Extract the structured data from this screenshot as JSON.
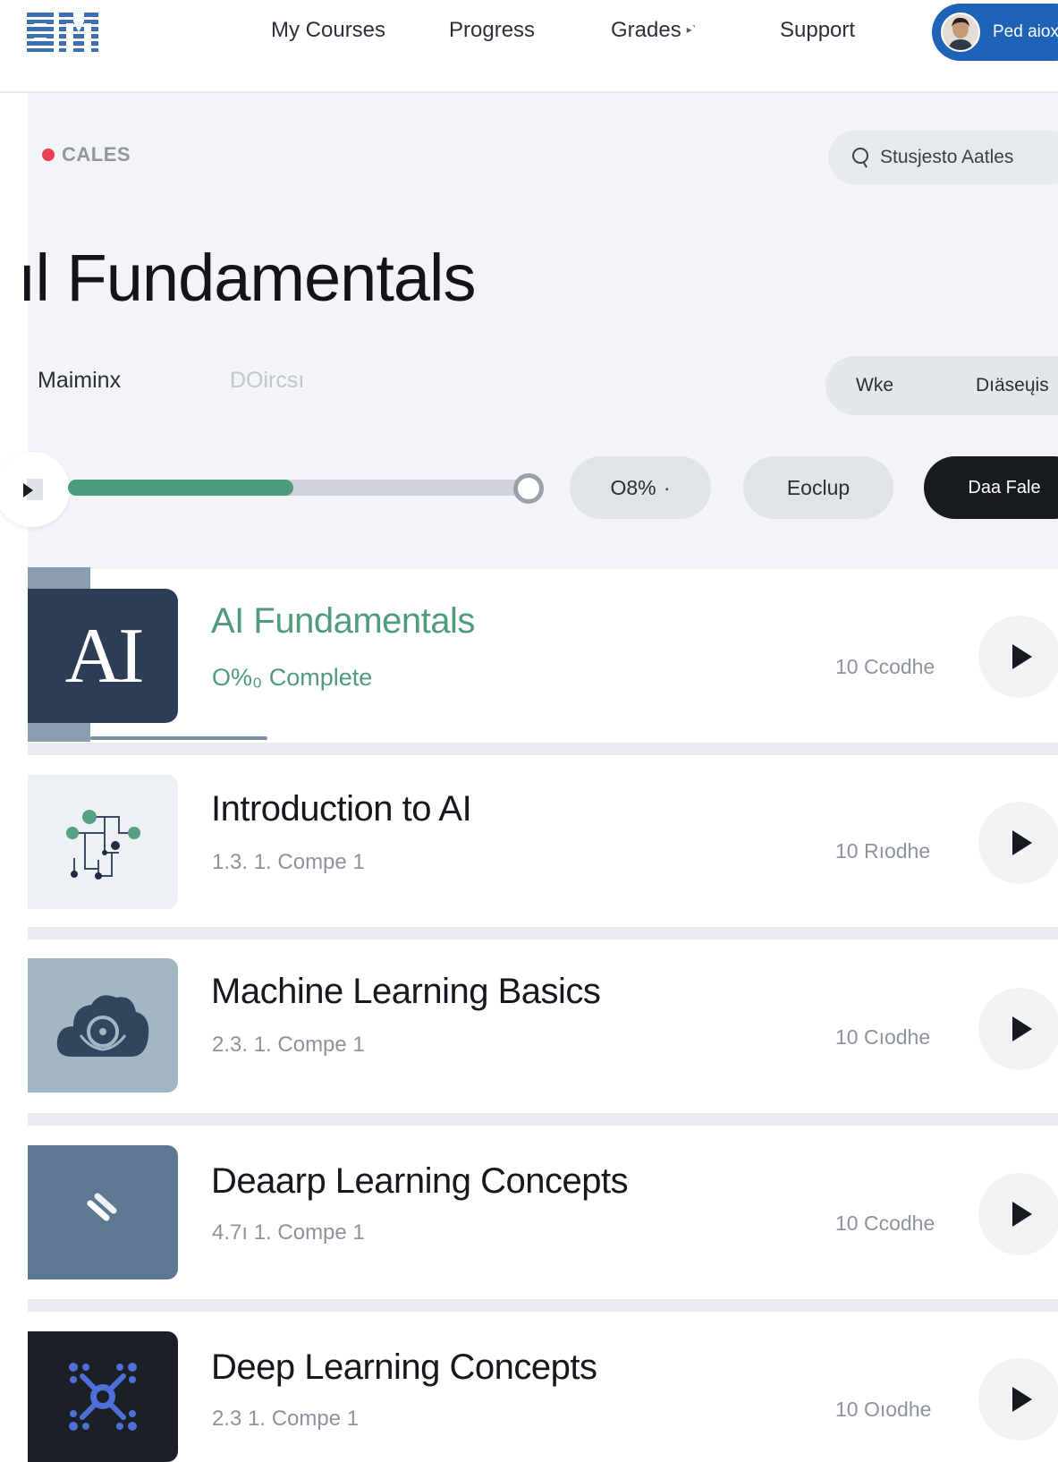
{
  "brand": {
    "logo_text": "BM"
  },
  "nav": {
    "links": [
      {
        "label": "My Courses"
      },
      {
        "label": "Progress"
      },
      {
        "label": "Grades"
      },
      {
        "label": "Support"
      }
    ],
    "user_label": "Ped aiox"
  },
  "header": {
    "category": "CALES",
    "search_label": "Stusjesto Aatles",
    "title": "ıl Fundamentals",
    "subtabs": [
      "Maiminx",
      "DOircsı"
    ],
    "segments": [
      "Wke",
      "Dıäseųis"
    ]
  },
  "progress": {
    "fill_fraction": 0.49,
    "percent_pill": "O8%  ·",
    "middle_pill": "Eoclup",
    "dark_pill": "Daa Fale"
  },
  "courses": [
    {
      "thumb_text": "AI",
      "title": "AI Fundamentals",
      "subtitle": "O%₀ Complete",
      "count": "10 Ccodhe",
      "active": true,
      "icon": "ai-icon",
      "color": "#2c3e55"
    },
    {
      "title": "Introduction to AI",
      "subtitle": "1.3.  1. Compe 1",
      "count": "10 Rıodhe",
      "icon": "circuit-icon",
      "color": "#eef1f4"
    },
    {
      "title": "Machine Learning Basics",
      "subtitle": "2.3.  1. Compe 1",
      "count": "10 Cıodhe",
      "icon": "cloud-brain-icon",
      "color": "#a2b6c4"
    },
    {
      "title": "Deaarp Learning Concepts",
      "subtitle": "4.7ı  1. Compe 1",
      "count": "10 Ccodhe",
      "icon": "slash-icon",
      "color": "#5e7891"
    },
    {
      "title": "Deep Learning Concepts",
      "subtitle": "2.3  1. Compe 1",
      "count": "10 Oıodhe",
      "icon": "network-icon",
      "color": "#1b1f26"
    }
  ],
  "colors": {
    "accent": "#4f9b7c",
    "brand_blue": "#1f63b8",
    "category_dot": "#ea3e52"
  }
}
